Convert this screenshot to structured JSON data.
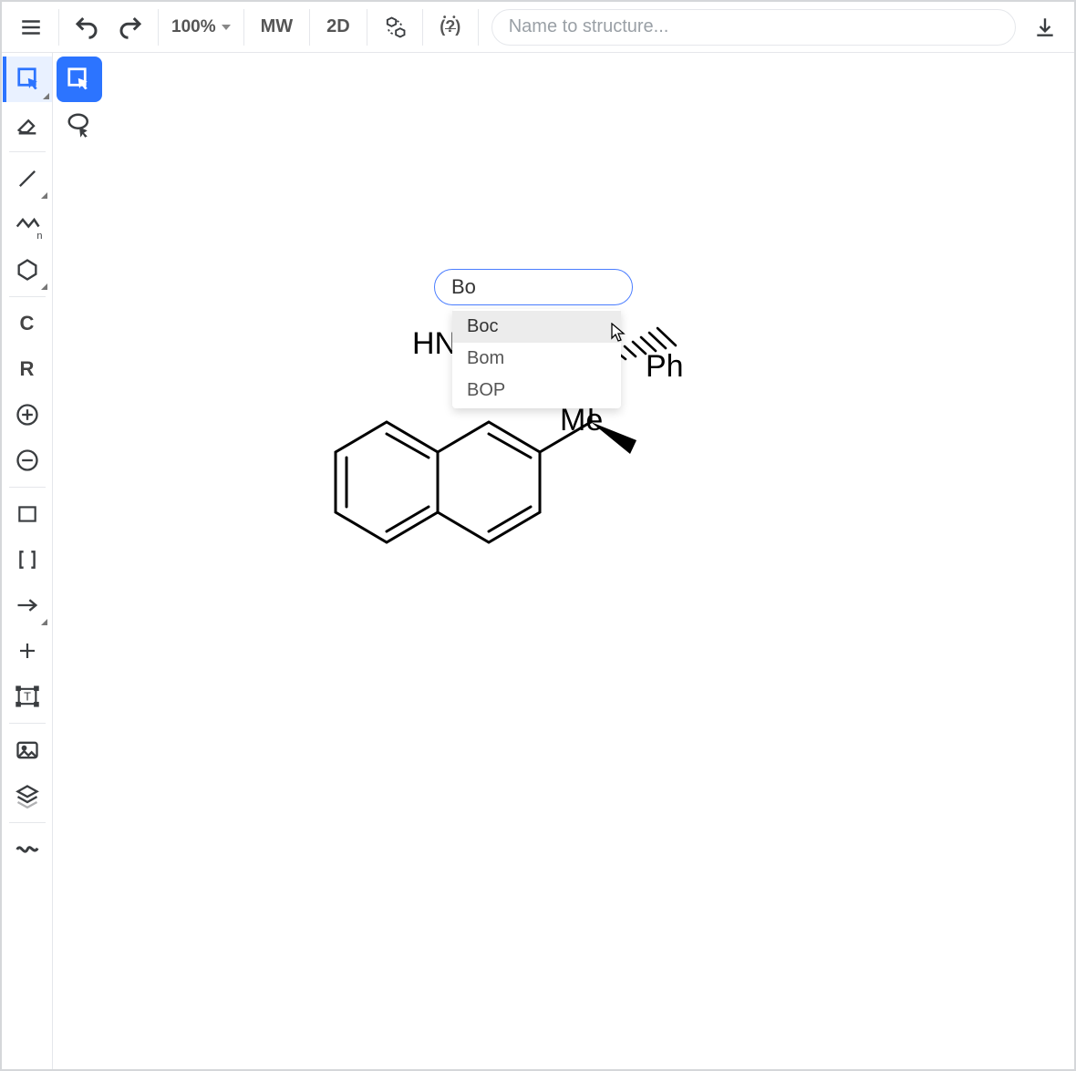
{
  "toolbar": {
    "zoom_label": "100%",
    "mw_label": "MW",
    "view_label": "2D",
    "search_placeholder": "Name to structure..."
  },
  "left_tools": {
    "carbon_label": "C",
    "r_label": "R"
  },
  "autocomplete": {
    "input_value": "Bo",
    "items": [
      {
        "label": "Boc",
        "highlighted": true
      },
      {
        "label": "Bom",
        "highlighted": false
      },
      {
        "label": "BOP",
        "highlighted": false
      }
    ]
  },
  "molecule": {
    "labels": {
      "hn": "HN",
      "ph": "Ph",
      "me": "Me"
    }
  }
}
